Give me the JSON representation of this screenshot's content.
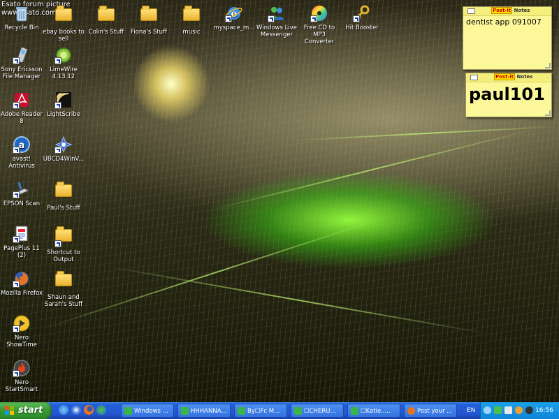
{
  "watermark": {
    "line1": "Esato forum picture",
    "line2": "www.esato.com"
  },
  "desktop_icons": [
    {
      "label": "Recycle Bin",
      "icon": "recycle-bin-icon"
    },
    {
      "label": "ebay books to sell",
      "icon": "folder-icon"
    },
    {
      "label": "Colin's Stuff",
      "icon": "folder-icon"
    },
    {
      "label": "Fiona's Stuff",
      "icon": "folder-icon"
    },
    {
      "label": "music",
      "icon": "folder-icon"
    },
    {
      "label": "myspace_m...",
      "icon": "internet-explorer-icon"
    },
    {
      "label": "Windows Live Messenger",
      "icon": "messenger-icon"
    },
    {
      "label": "Free CD to MP3 Converter",
      "icon": "cd-icon"
    },
    {
      "label": "Hit Booster",
      "icon": "key-icon"
    },
    {
      "label": "Sony Ericsson File Manager",
      "icon": "phone-icon"
    },
    {
      "label": "LimeWire 4.13.12",
      "icon": "limewire-icon"
    },
    {
      "label": "Adobe Reader 8",
      "icon": "adobe-reader-icon"
    },
    {
      "label": "LightScribe",
      "icon": "lightscribe-icon"
    },
    {
      "label": "avast! Antivirus",
      "icon": "avast-icon"
    },
    {
      "label": "UBCD4WinV...",
      "icon": "ubcd-icon"
    },
    {
      "label": "EPSON Scan",
      "icon": "scanner-icon"
    },
    {
      "label": "Paul's Stuff",
      "icon": "folder-icon"
    },
    {
      "label": "PagePlus 11 (2)",
      "icon": "pageplus-icon"
    },
    {
      "label": "Shortcut to Output",
      "icon": "folder-icon"
    },
    {
      "label": "Mozilla Firefox",
      "icon": "firefox-icon"
    },
    {
      "label": "Shaun and Sarah's Stuff",
      "icon": "folder-icon"
    },
    {
      "label": "Nero ShowTime",
      "icon": "nero-showtime-icon"
    },
    {
      "label": "Nero StartSmart",
      "icon": "nero-startsmart-icon"
    }
  ],
  "notes": [
    {
      "brand": "Post-it",
      "title": "Notes",
      "text": "dentist app 091007"
    },
    {
      "brand": "Post-it",
      "title": "Notes",
      "text": "paul101"
    }
  ],
  "taskbar": {
    "start_label": "start",
    "quick_launch": [
      "internet-explorer-icon",
      "media-player-icon",
      "firefox-icon",
      "messenger-icon"
    ],
    "tasks": [
      {
        "label": "Windows ...",
        "icon": "messenger-icon",
        "color": "#39b54a"
      },
      {
        "label": "HHHANNA...",
        "icon": "messenger-icon",
        "color": "#39b54a"
      },
      {
        "label": "By☐Fc M...",
        "icon": "messenger-icon",
        "color": "#39b54a"
      },
      {
        "label": "☐CHERU...",
        "icon": "messenger-icon",
        "color": "#39b54a"
      },
      {
        "label": "☐Katie.....",
        "icon": "messenger-icon",
        "color": "#39b54a"
      },
      {
        "label": "Post your ...",
        "icon": "firefox-icon",
        "color": "#e8731c"
      }
    ],
    "language": "EN",
    "tray_icons": [
      "network-icon",
      "messenger-icon",
      "volume-icon",
      "avast-icon",
      "nero-icon"
    ],
    "clock": "16:56"
  },
  "colors": {
    "taskbar_blue": "#245edb",
    "start_green": "#3a9a36",
    "tray_blue": "#0e84d8",
    "note_yellow": "#fcf89a"
  }
}
